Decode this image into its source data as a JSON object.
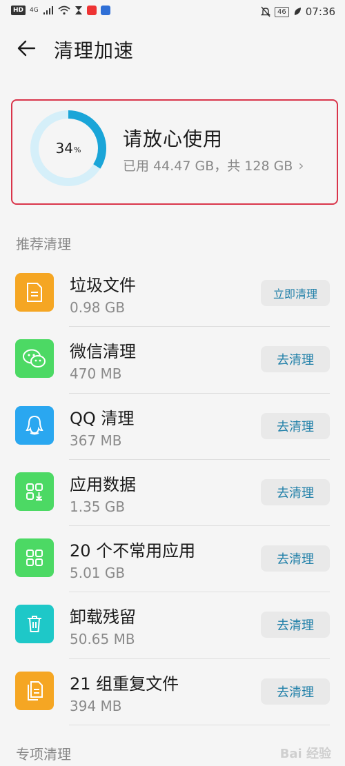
{
  "status_bar": {
    "left_chip": "HD",
    "signal_label": "4G",
    "battery": "46",
    "time": "07:36"
  },
  "header": {
    "title": "清理加速"
  },
  "storage": {
    "percent": "34",
    "percent_unit": "%",
    "used_fraction": 0.34,
    "status": "请放心使用",
    "usage": "已用 44.47 GB，共 128 GB",
    "ring_color": "#1aa5d8",
    "ring_track_color": "#d5eff9"
  },
  "sections": {
    "recommended": "推荐清理",
    "special": "专项清理"
  },
  "items": [
    {
      "title": "垃圾文件",
      "sub": "0.98 GB",
      "button": "立即清理",
      "icon": "document-icon",
      "color": "#f5a623"
    },
    {
      "title": "微信清理",
      "sub": "470 MB",
      "button": "去清理",
      "icon": "wechat-icon",
      "color": "#4cd964"
    },
    {
      "title": "QQ 清理",
      "sub": "367 MB",
      "button": "去清理",
      "icon": "qq-icon",
      "color": "#2aa7f0"
    },
    {
      "title": "应用数据",
      "sub": "1.35 GB",
      "button": "去清理",
      "icon": "app-data-icon",
      "color": "#4cd964"
    },
    {
      "title": "20 个不常用应用",
      "sub": "5.01 GB",
      "button": "去清理",
      "icon": "apps-grid-icon",
      "color": "#4cd964"
    },
    {
      "title": "卸载残留",
      "sub": "50.65 MB",
      "button": "去清理",
      "icon": "trash-icon",
      "color": "#1ec8c8"
    },
    {
      "title": "21 组重复文件",
      "sub": "394 MB",
      "button": "去清理",
      "icon": "duplicate-files-icon",
      "color": "#f5a623"
    }
  ],
  "watermark": "Bai 经验"
}
